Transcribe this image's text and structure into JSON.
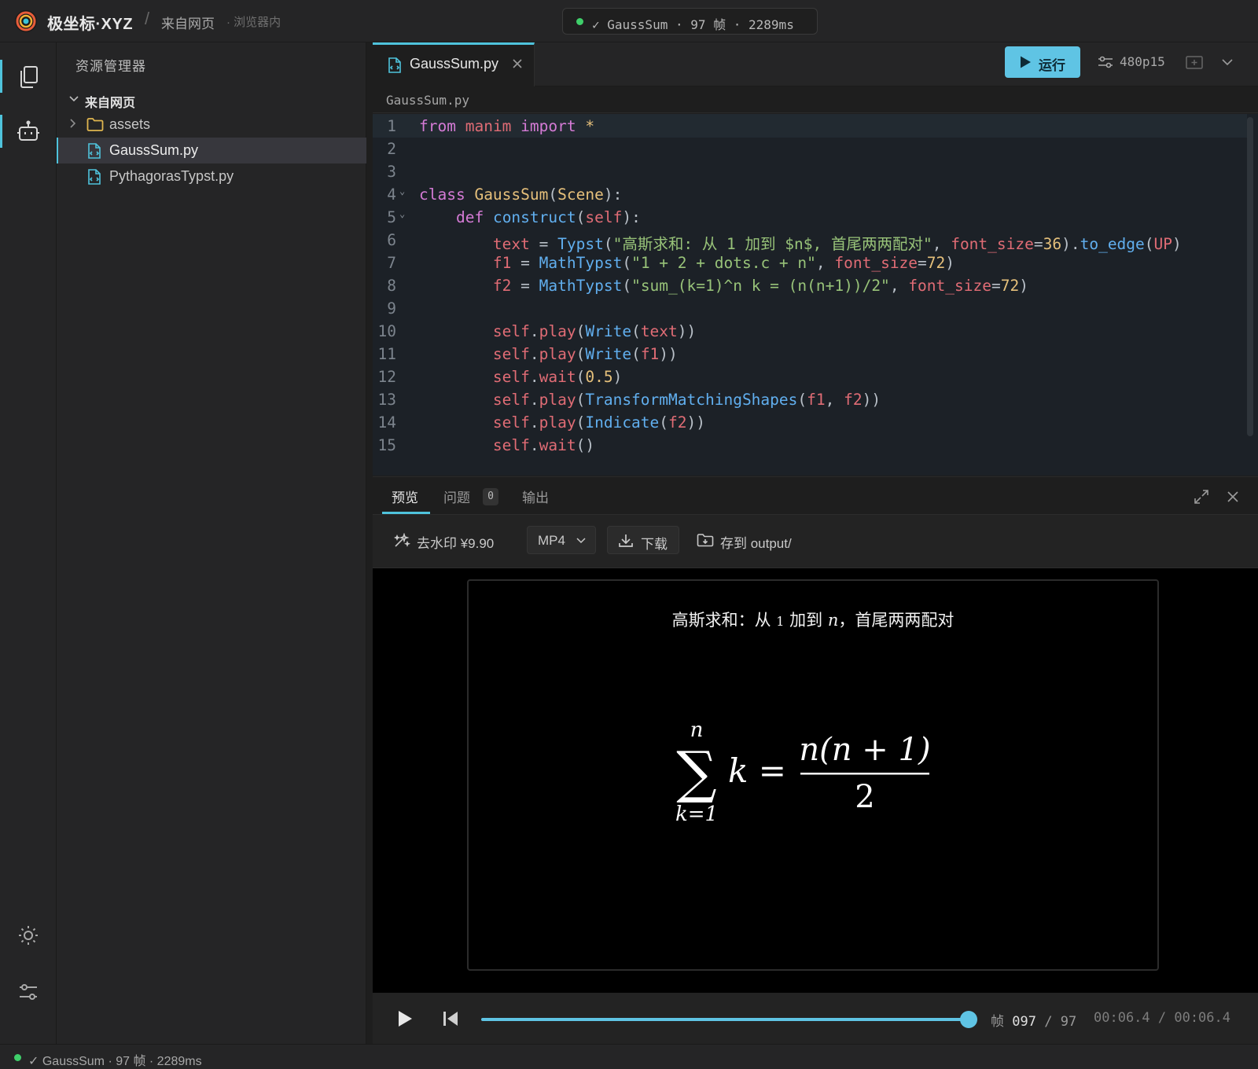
{
  "app": {
    "brand": "极坐标·XYZ",
    "breadcrumb": "来自网页",
    "breadcrumb_note": "· 浏览器内",
    "status_pill": "✓ GaussSum · 97 帧 · 2289ms"
  },
  "sidebar": {
    "title": "资源管理器",
    "root_label": "来自网页",
    "items": [
      {
        "label": "assets",
        "type": "folder"
      },
      {
        "label": "GaussSum.py",
        "type": "python-file",
        "selected": true
      },
      {
        "label": "PythagorasTypst.py",
        "type": "python-file"
      }
    ]
  },
  "editor": {
    "tab_label": "GaussSum.py",
    "run_label": "运行",
    "quality": "480p15",
    "path": "GaussSum.py",
    "code_lines": [
      {
        "n": "1"
      },
      {
        "n": "2"
      },
      {
        "n": "3"
      },
      {
        "n": "4"
      },
      {
        "n": "5"
      },
      {
        "n": "6"
      },
      {
        "n": "7"
      },
      {
        "n": "8"
      },
      {
        "n": "9"
      },
      {
        "n": "10"
      },
      {
        "n": "11"
      },
      {
        "n": "12"
      },
      {
        "n": "13"
      },
      {
        "n": "14"
      },
      {
        "n": "15"
      }
    ],
    "code": {
      "l1": [
        "from",
        "manim",
        "import",
        "*"
      ],
      "l4": [
        "class",
        "GaussSum",
        "Scene"
      ],
      "l5": [
        "def",
        "construct",
        "self"
      ],
      "l6": [
        "text",
        "Typst",
        "\"高斯求和: 从 1 加到 $n$, 首尾两两配对\"",
        "font_size",
        "36",
        "to_edge",
        "UP"
      ],
      "l7": [
        "f1",
        "MathTypst",
        "\"1 + 2 + dots.c + n\"",
        "font_size",
        "72"
      ],
      "l8": [
        "f2",
        "MathTypst",
        "\"sum_(k=1)^n k = (n(n+1))/2\"",
        "font_size",
        "72"
      ],
      "l10": [
        "self",
        "play",
        "Write",
        "text"
      ],
      "l11": [
        "self",
        "play",
        "Write",
        "f1"
      ],
      "l12": [
        "self",
        "wait",
        "0.5"
      ],
      "l13": [
        "self",
        "play",
        "TransformMatchingShapes",
        "f1",
        "f2"
      ],
      "l14": [
        "self",
        "play",
        "Indicate",
        "f2"
      ],
      "l15": [
        "self",
        "wait"
      ]
    }
  },
  "panel": {
    "tabs": {
      "preview": "预览",
      "problems": "问题",
      "problems_count": "0",
      "output": "输出"
    },
    "toolbar": {
      "watermark": "去水印 ¥9.90",
      "format": "MP4",
      "download": "下载",
      "save_to": "存到 output/"
    },
    "video": {
      "title_part1": "高斯求和：从",
      "title_num": "1",
      "title_part2": "加到",
      "title_var": "n",
      "title_part3": "，首尾两两配对",
      "formula": {
        "upper": "n",
        "sum": "∑",
        "lower": "k=1",
        "term": "k =",
        "numerator": "n(n + 1)",
        "denominator": "2"
      }
    },
    "playback": {
      "frame_label": "帧",
      "frame_current": "097",
      "frame_sep": "/",
      "frame_total": "97",
      "time": "00:06.4 / 00:06.4",
      "progress": 1.0
    }
  },
  "statusbar": {
    "text": "✓ GaussSum · 97 帧 · 2289ms"
  },
  "colors": {
    "accent": "#4fc3dc",
    "run_button": "#5fc4e4",
    "status_ok": "#3fcf6a"
  }
}
